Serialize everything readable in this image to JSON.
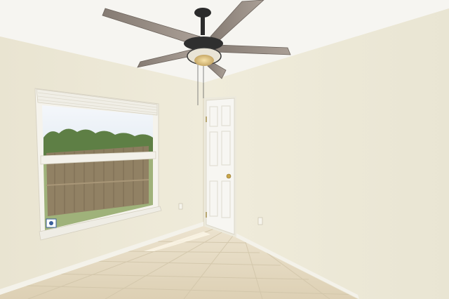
{
  "scene": {
    "description_free": true,
    "room": "empty-bedroom",
    "colors": {
      "left_wall": "#ece8d6",
      "right_wall": "#efebd9",
      "ceiling": "#f6f5f1",
      "floor": "#e6dcc6",
      "grout": "#cfc3a8",
      "trim": "#f4f2ea",
      "door": "#f7f6f2",
      "fan_blade": "#9a8f86",
      "fan_hardware": "#2b2b2b",
      "sky": "#eef3f8",
      "trees": "#5e7f45",
      "fence": "#8f7d62",
      "grass": "#9fb27a"
    },
    "objects": [
      "ceiling-fan",
      "window",
      "door",
      "door-knob",
      "wall-outlet",
      "tile-floor",
      "baseboard"
    ]
  }
}
